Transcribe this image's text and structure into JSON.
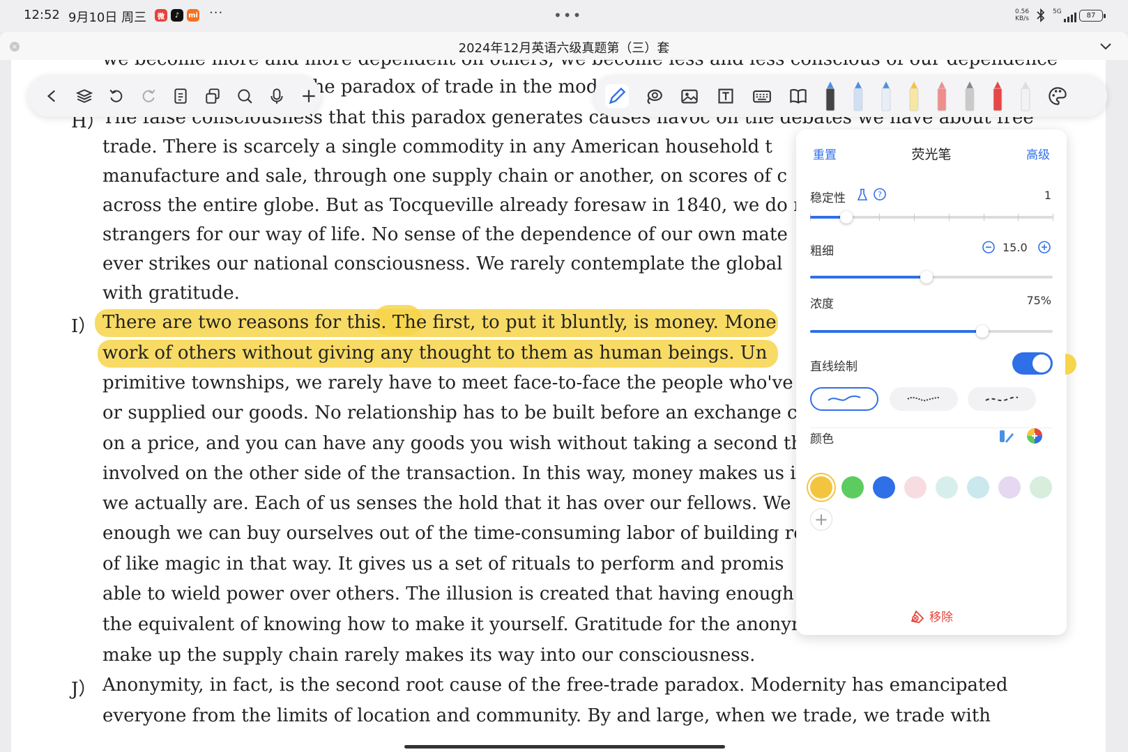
{
  "status_bar": {
    "time": "12:52",
    "date": "9月10日 周三",
    "app_icons": [
      {
        "name": "weibo-app-icon",
        "text": "微",
        "color": "#e8413d"
      },
      {
        "name": "douyin-app-icon",
        "text": "♪",
        "color": "#111111"
      },
      {
        "name": "mi-app-icon",
        "text": "mi",
        "color": "#f5701f"
      }
    ],
    "more": "···",
    "net_speed_value": "0.56",
    "net_speed_unit": "KB/s",
    "network": "5G",
    "battery": "87"
  },
  "window": {
    "center_dots": "•••",
    "title": "2024年12月英语六级真题第（三）套"
  },
  "document": {
    "markers": {
      "h": "H）",
      "i": "I）",
      "j": "J）"
    },
    "lines": [
      "we become more and more dependent on others, we become less and less conscious of our dependence",
      "the paradox of trade in the modern",
      "The false consciousness that this paradox generates causes havoc on the debates we have about free",
      "trade. There is scarcely a single commodity in any American household t",
      "manufacture and sale, through one supply chain or another, on scores of c",
      "across the entire globe. But as Tocqueville already foresaw in 1840, we do r",
      "strangers for our way of life. No sense of the dependence of our own mate",
      "ever strikes our national consciousness. We rarely contemplate the global",
      "with gratitude.",
      "There are two reasons for this. The first, to put it bluntly, is money. Mone",
      "work of others without giving any thought to them as human beings. Un",
      "primitive townships, we rarely have to meet face-to-face the people who've",
      "or supplied our goods. No relationship has to be built before an exchange ca",
      "on a price, and you can have any goods you wish without taking a second th",
      "involved on the other side of the transaction. In this way, money makes us i",
      "we actually are. Each of us senses the hold that it has over our fellows. We",
      "enough we can buy ourselves out of the time-consuming labor of building re",
      "of like magic in that way. It gives us a set of rituals to perform and promis",
      "able to wield power over others. The illusion is created that having enough",
      "the equivalent of knowing how to make it yourself. Gratitude for the anonymous men and women who",
      "make up the supply chain rarely makes its way into our consciousness.",
      "Anonymity, in fact, is the second root cause of the free-trade paradox. Modernity has emancipated",
      "everyone from the limits of location and community. By and large, when we trade, we trade with"
    ]
  },
  "toolbar": {
    "left_tools": [
      "back-icon",
      "layers-icon",
      "undo-icon",
      "redo-icon",
      "document-icon",
      "copy-icon",
      "search-icon",
      "microphone-icon",
      "add-icon"
    ],
    "right_tools": [
      "pencil-icon",
      "lasso-icon",
      "image-icon",
      "textbox-icon",
      "keyboard-icon",
      "book-icon"
    ],
    "pens": [
      {
        "name": "fountain-pen",
        "color": "#444444",
        "tip": "#4a90e2"
      },
      {
        "name": "ballpoint-pen",
        "color": "#cfe0f5",
        "tip": "#4a90e2"
      },
      {
        "name": "marker-pen",
        "color": "#e7eef8",
        "tip": "#4a90e2"
      },
      {
        "name": "highlighter-pen",
        "color": "#f7e7a0",
        "tip": "#f3c53f"
      },
      {
        "name": "eraser",
        "color": "#f08d8d",
        "tip": "#f08d8d"
      },
      {
        "name": "pencil-tool",
        "color": "#c9c9c9",
        "tip": "#888888"
      },
      {
        "name": "red-marker",
        "color": "#e84545",
        "tip": "#e84545"
      },
      {
        "name": "ruler",
        "color": "#f2f2f2",
        "tip": "#dddddd"
      }
    ]
  },
  "panel": {
    "reset": "重置",
    "title": "荧光笔",
    "advanced": "高级",
    "stability_label": "稳定性",
    "stability_value": "1",
    "stability": 0.15,
    "thickness_label": "粗细",
    "thickness_value": "15.0",
    "thickness": 0.48,
    "opacity_label": "浓度",
    "opacity_value": "75%",
    "opacity": 0.71,
    "straight_line_label": "直线绘制",
    "straight_line_on": true,
    "color_label": "颜色",
    "colors": [
      "#f3c53f",
      "#5ccc5f",
      "#2f6fe8",
      "#f7dde2",
      "#d7efec",
      "#cbe8ee",
      "#e6d8f0",
      "#d7eedd"
    ],
    "selected_color": 0,
    "remove_label": "移除"
  }
}
